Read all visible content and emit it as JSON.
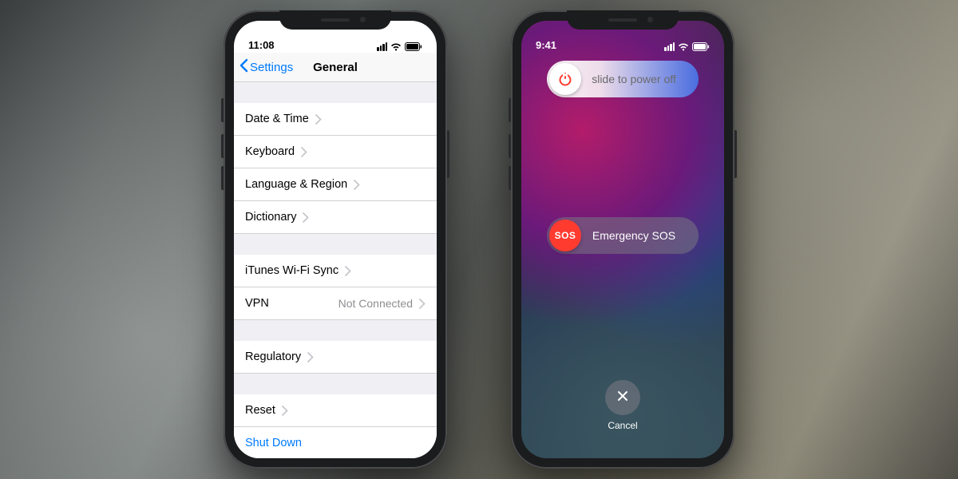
{
  "left": {
    "status_time": "11:08",
    "nav_back": "Settings",
    "nav_title": "General",
    "groups": [
      [
        {
          "label": "Date & Time"
        },
        {
          "label": "Keyboard"
        },
        {
          "label": "Language & Region"
        },
        {
          "label": "Dictionary"
        }
      ],
      [
        {
          "label": "iTunes Wi-Fi Sync"
        },
        {
          "label": "VPN",
          "value": "Not Connected"
        }
      ],
      [
        {
          "label": "Regulatory"
        }
      ],
      [
        {
          "label": "Reset"
        }
      ]
    ],
    "shutdown_label": "Shut Down"
  },
  "right": {
    "status_time": "9:41",
    "power_slider_label": "slide to power off",
    "sos_knob_label": "SOS",
    "sos_slider_label": "Emergency SOS",
    "cancel_label": "Cancel"
  }
}
